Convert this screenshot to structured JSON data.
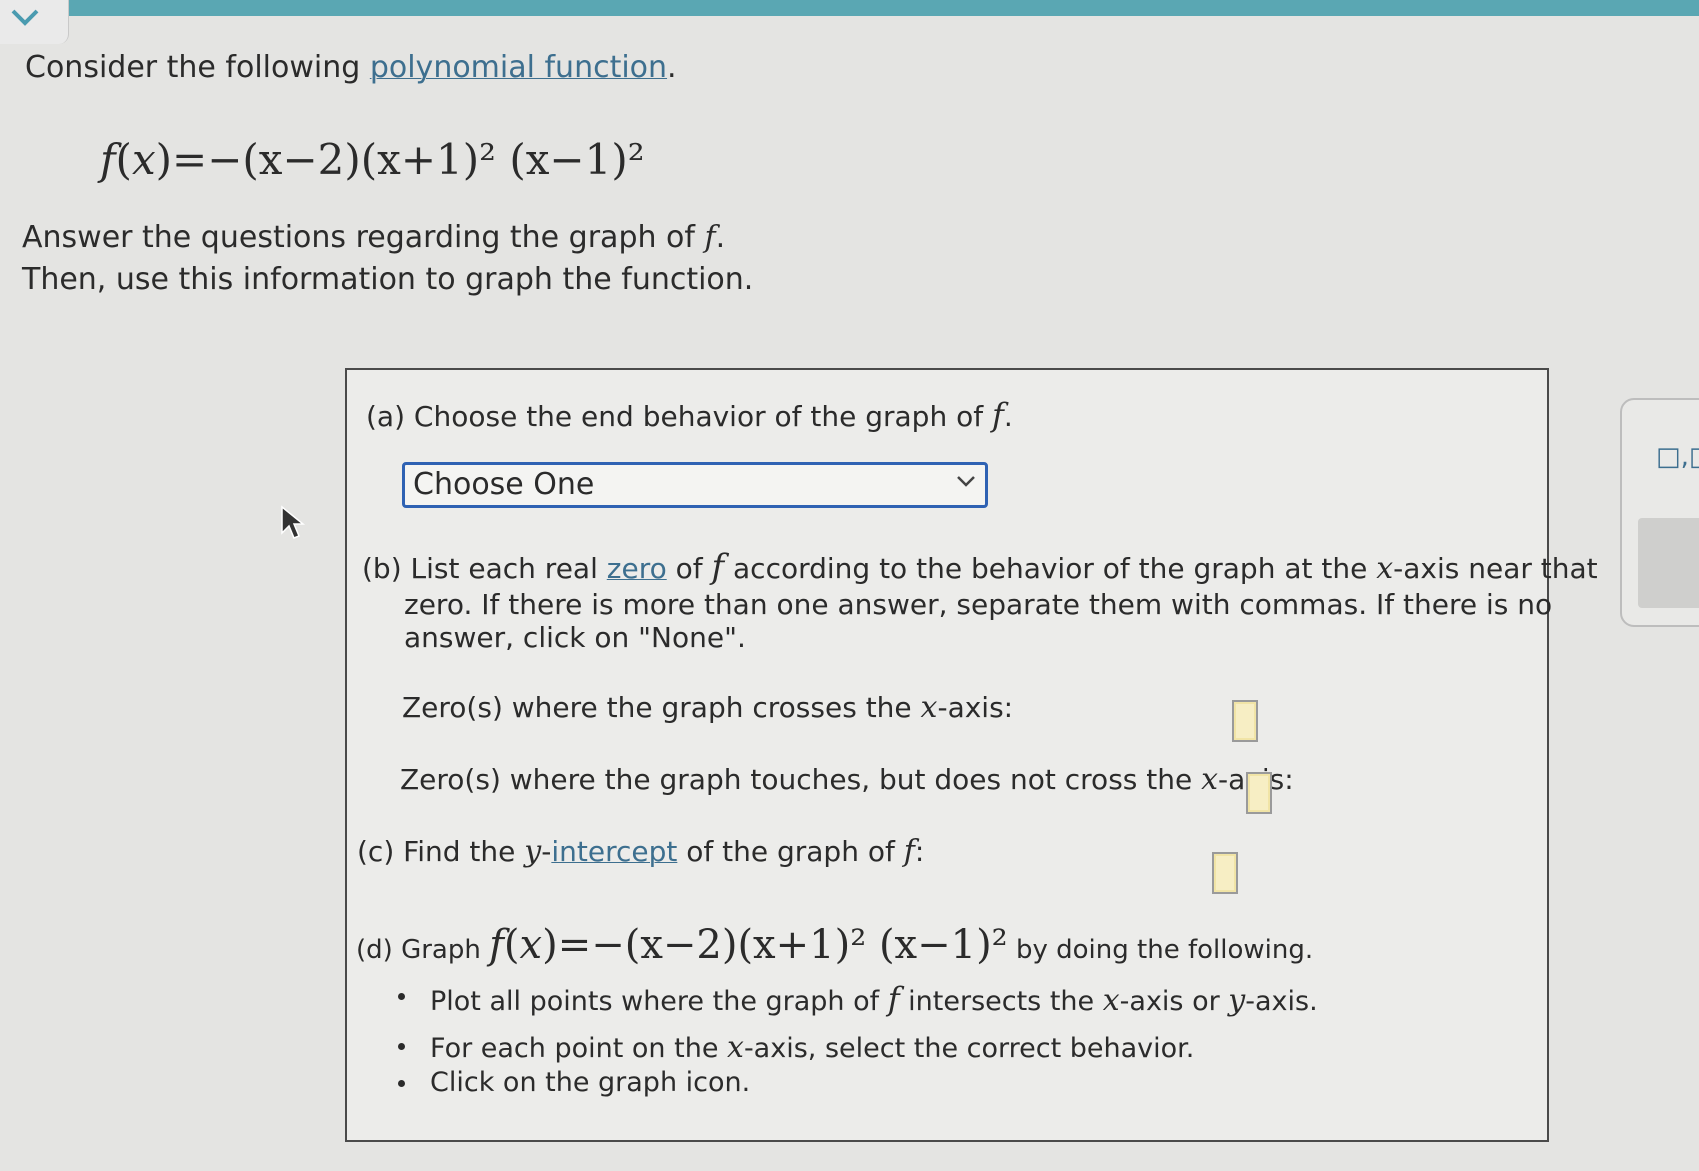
{
  "intro": {
    "lead": "Consider the following ",
    "link": "polynomial function",
    "tail": "."
  },
  "formula": {
    "f": "f",
    "x": "x",
    "rhs_text": "=−(x−2)(x+1)² (x−1)²"
  },
  "instructions": {
    "line1_text": "Answer the questions regarding the graph of ",
    "line1_var": "f",
    "line2": "Then, use this information to graph the function."
  },
  "part_a": {
    "marker": "(a)",
    "text": "Choose the end behavior of the graph of ",
    "var": "f",
    "dropdown_value": "Choose One"
  },
  "part_b": {
    "marker": "(b)",
    "line1_pre": "List each real ",
    "line1_link": "zero",
    "line1_mid": " of ",
    "line1_var": "f",
    "line1_post": " according to the behavior of the graph at the ",
    "axis_var": "x",
    "line1_end": "-axis near that",
    "line2": "zero. If there is more than one answer, separate them with commas. If there is no",
    "line3": "answer, click on \"None\".",
    "crosses_label_pre": "Zero(s) where the graph crosses the ",
    "crosses_label_post": "-axis:",
    "touches_label_pre": "Zero(s) where the graph touches, but does not cross the ",
    "touches_label_post": "-axis:"
  },
  "part_c": {
    "marker": "(c)",
    "text_pre": "Find the ",
    "var_y": "y",
    "dash": "-",
    "link": "intercept",
    "text_post": " of the graph of ",
    "var_f": "f",
    "colon": ":"
  },
  "part_d": {
    "marker": "(d)",
    "graph_label": "Graph ",
    "suffix": " by doing the following.",
    "bullets": [
      {
        "pre": "Plot all points where the graph of ",
        "v1": "f",
        "mid": " intersects the ",
        "v2": "x",
        "mid2": "-axis or ",
        "v3": "y",
        "post": "-axis."
      },
      {
        "pre": "For each point on the ",
        "v1": "x",
        "post": "-axis, select the correct behavior."
      },
      {
        "text": "Click on the graph icon."
      }
    ]
  },
  "side_panel": {
    "icon": "□,□"
  },
  "colors": {
    "accent": "#5aa7b3",
    "link": "#3d6f8f",
    "dropdown_border": "#2f62b3",
    "answer_box_fill": "#f7eec4"
  }
}
